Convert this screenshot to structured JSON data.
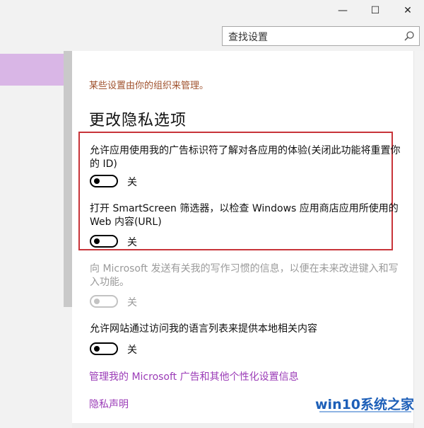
{
  "window_controls": {
    "minimize": "—",
    "maximize": "☐",
    "close": "✕"
  },
  "search": {
    "placeholder": "查找设置"
  },
  "managed_notice": "某些设置由你的组织来管理。",
  "page_title": "更改隐私选项",
  "settings": [
    {
      "description": "允许应用使用我的广告标识符了解对各应用的体验(关闭此功能将重置你的 ID)",
      "state": "关",
      "on": false,
      "enabled": true
    },
    {
      "description": "打开 SmartScreen 筛选器，以检查 Windows 应用商店应用所使用的 Web 内容(URL)",
      "state": "关",
      "on": false,
      "enabled": true
    },
    {
      "description": "向 Microsoft 发送有关我的写作习惯的信息，以便在未来改进键入和写入功能。",
      "state": "关",
      "on": false,
      "enabled": false
    },
    {
      "description": "允许网站通过访问我的语言列表来提供本地相关内容",
      "state": "关",
      "on": false,
      "enabled": true
    }
  ],
  "links": {
    "manage_ads": "管理我的 Microsoft 广告和其他个性化设置信息",
    "privacy": "隐私声明"
  },
  "watermark": "win10系统之家",
  "colors": {
    "accent_link": "#9b3cb7",
    "managed_text": "#a0522d",
    "highlight_box": "#c8343a",
    "sidebar_selected": "#d9b6e6"
  }
}
